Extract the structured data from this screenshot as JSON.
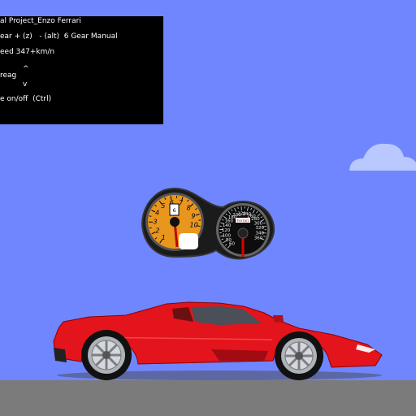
{
  "info": {
    "title": "al Project_Enzo Ferrari",
    "gear": "ear + (z)   - (alt)  6 Gear Manual",
    "speed": "eed 347+km/n",
    "arrow_up": "^",
    "brake": "reag",
    "arrow_down": "v",
    "toggle": "e on/off  (Ctrl)"
  },
  "tachometer": {
    "labels": [
      "1",
      "2",
      "3",
      "4",
      "5",
      "6",
      "7",
      "8",
      "9",
      "10"
    ],
    "gear_indicator": "6",
    "face_color": "#e8961e"
  },
  "speedometer": {
    "labels": [
      "60",
      "80",
      "100",
      "120",
      "140",
      "160",
      "180",
      "200",
      "220",
      "240",
      "260",
      "280",
      "300",
      "320",
      "340",
      "360"
    ],
    "badge": "Ferrari"
  },
  "colors": {
    "sky": "#6f86ff",
    "ground": "#7b7b7b",
    "car_body": "#e4141c"
  }
}
